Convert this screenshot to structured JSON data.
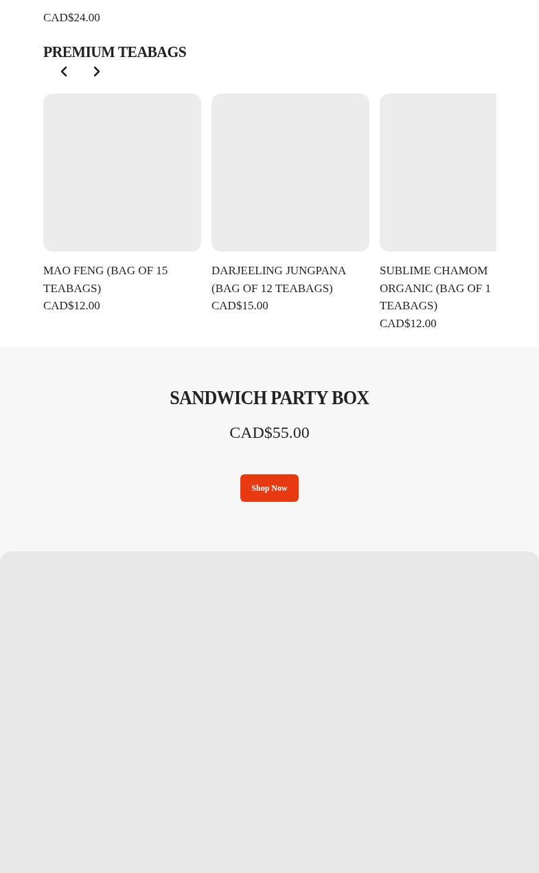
{
  "previous_product": {
    "price": "CAD$24.00"
  },
  "section": {
    "title": "PREMIUM TEABAGS",
    "products": [
      {
        "lines": [
          "MAO FENG (BAG OF 15",
          "TEABAGS)"
        ],
        "price": "CAD$12.00"
      },
      {
        "lines": [
          "DARJEELING JUNGPANA",
          "(BAG OF 12 TEABAGS)"
        ],
        "price": "CAD$15.00"
      },
      {
        "lines": [
          "SUBLIME CHAMOM",
          "ORGANIC (BAG OF 1",
          "TEABAGS)"
        ],
        "price": "CAD$12.00"
      }
    ]
  },
  "feature": {
    "title": "SANDWICH PARTY BOX",
    "price": "CAD$55.00",
    "button": "Shop Now"
  }
}
